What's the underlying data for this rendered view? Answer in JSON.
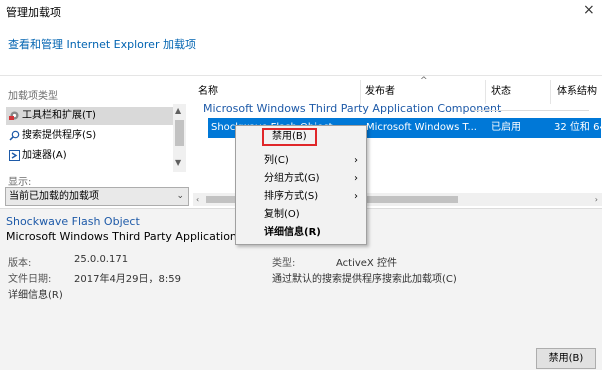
{
  "window": {
    "title": "管理加载项",
    "close": "×"
  },
  "subtitle": "查看和管理 Internet Explorer 加载项",
  "left": {
    "type_label": "加载项类型",
    "types": [
      {
        "label": "工具栏和扩展(T)",
        "icon": "toolbar-gear-icon"
      },
      {
        "label": "搜索提供程序(S)",
        "icon": "search-icon"
      },
      {
        "label": "加速器(A)",
        "icon": "accelerator-icon"
      }
    ],
    "show_label": "显示:",
    "show_value": "当前已加载的加载项"
  },
  "columns": [
    "名称",
    "发布者",
    "状态",
    "体系结构"
  ],
  "group": "Microsoft Windows Third Party Application Component",
  "row": {
    "name": "Shockwave Flash Object",
    "publisher": "Microsoft Windows T...",
    "status": "已启用",
    "arch": "32 位和 64"
  },
  "menu": {
    "items": [
      "禁用(B)",
      "列(C)",
      "分组方式(G)",
      "排序方式(S)",
      "复制(O)",
      "详细信息(R)"
    ]
  },
  "details": {
    "name": "Shockwave Flash Object",
    "publisher": "Microsoft Windows Third Party Application Component",
    "version_label": "版本:",
    "version": "25.0.0.171",
    "date_label": "文件日期:",
    "date": "2017年4月29日，8:59",
    "more_link": "详细信息(R)",
    "type_label": "类型:",
    "type": "ActiveX 控件",
    "search_link": "通过默认的搜索提供程序搜索此加载项(C)"
  },
  "buttons": {
    "disable": "禁用(B)"
  },
  "colors": {
    "accent": "#0078d7",
    "link": "#0063b1",
    "highlight": "#e0272a"
  }
}
